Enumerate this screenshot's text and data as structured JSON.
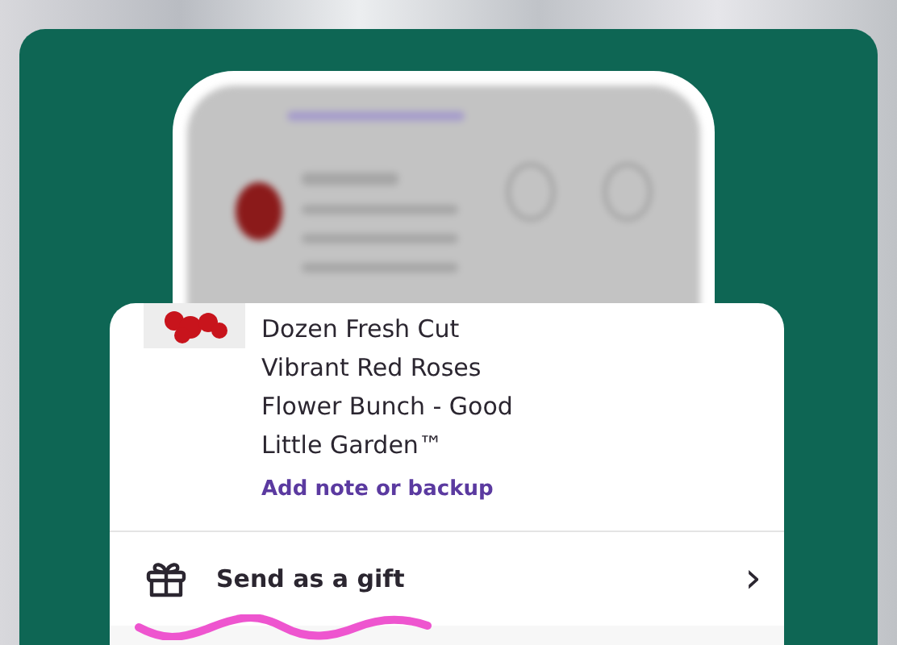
{
  "product": {
    "name_lines": [
      "Dozen Fresh Cut",
      "Vibrant Red Roses",
      "Flower Bunch - Good",
      "Little Garden™"
    ],
    "note_link": "Add note or backup"
  },
  "gift_row": {
    "label": "Send as a gift",
    "chevron": "›"
  }
}
